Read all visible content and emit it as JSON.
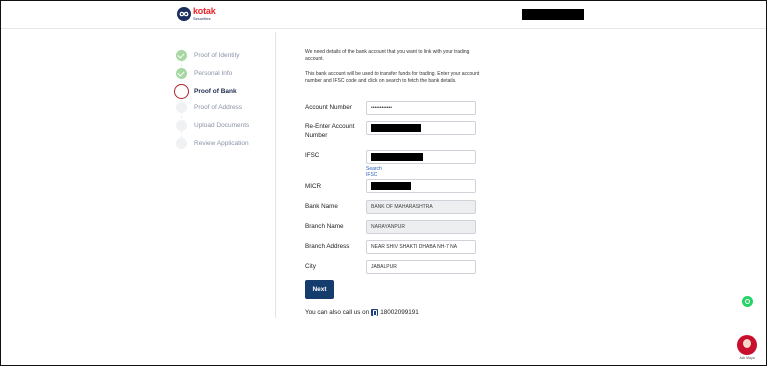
{
  "header": {
    "brand_name": "kotak",
    "brand_sub": "Securities"
  },
  "stepper": {
    "steps": [
      {
        "label": "Proof of Identity",
        "state": "done"
      },
      {
        "label": "Personal Info",
        "state": "done"
      },
      {
        "label": "Proof of Bank",
        "state": "current"
      },
      {
        "label": "Proof of Address",
        "state": "pending"
      },
      {
        "label": "Upload Documents",
        "state": "pending"
      },
      {
        "label": "Review Application",
        "state": "pending"
      }
    ]
  },
  "intro": {
    "para1": "We need details of the bank account that you want to link with your trading account.",
    "para2": "This bank account will be used to transfer funds for trading. Enter your account number and IFSC code and click on search to fetch the bank details."
  },
  "form": {
    "account_number": {
      "label": "Account Number",
      "value": "••••••••••••"
    },
    "reenter_account": {
      "label": "Re-Enter Account Number"
    },
    "ifsc": {
      "label": "IFSC",
      "link": "Search IFSC"
    },
    "micr": {
      "label": "MICR"
    },
    "bank_name": {
      "label": "Bank Name",
      "value": "BANK OF MAHARASHTRA"
    },
    "branch_name": {
      "label": "Branch Name",
      "value": "NARAYANPUR"
    },
    "branch_address": {
      "label": "Branch Address",
      "value": "NEAR SHIV SHAKTI DHABA  NH-7  NA"
    },
    "city": {
      "label": "City",
      "value": "JABALPUR"
    }
  },
  "actions": {
    "next_label": "Next"
  },
  "contact": {
    "prefix": "You can also call us on",
    "phone": "18002099191"
  },
  "assistant": {
    "label": "Ask Maya"
  },
  "colors": {
    "accent": "#143c6d",
    "brand_red": "#ed232a",
    "done_green": "#a7d7a2",
    "current_ring": "#b3202b",
    "link": "#2a62b8"
  },
  "icons": [
    "kotak-logo-icon",
    "check-icon",
    "phone-icon",
    "whatsapp-icon",
    "maya-avatar-icon"
  ]
}
